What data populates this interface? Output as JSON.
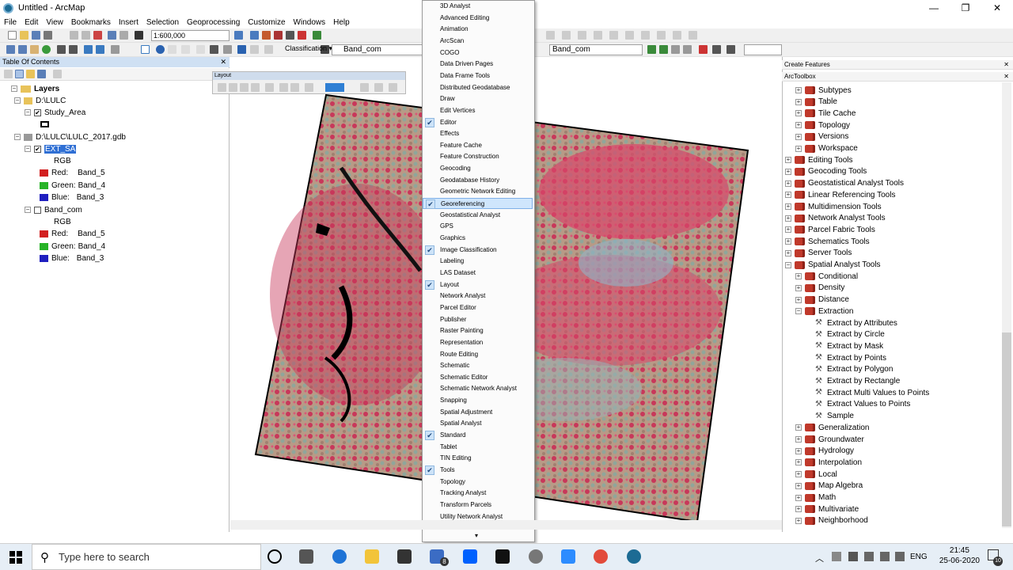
{
  "window": {
    "title": "Untitled - ArcMap",
    "min": "—",
    "max": "❐",
    "close": "✕"
  },
  "menubar": [
    "File",
    "Edit",
    "View",
    "Bookmarks",
    "Insert",
    "Selection",
    "Geoprocessing",
    "Customize",
    "Windows",
    "Help"
  ],
  "toolbar": {
    "scale": "1:600,000",
    "classification_label": "Classification ▾",
    "band_select": "Band_com",
    "band_select_2": "Band_com"
  },
  "toc": {
    "header": "Table Of Contents",
    "layers_root": "Layers",
    "group1": "D:\\LULC",
    "study_area": "Study_Area",
    "group2": "D:\\LULC\\LULC_2017.gdb",
    "ext_sa": "EXT_SA",
    "rgb1": "RGB",
    "red1": "Red:",
    "red1_band": "Band_5",
    "green1": "Green:",
    "green1_band": "Band_4",
    "blue1": "Blue:",
    "blue1_band": "Band_3",
    "band_com": "Band_com",
    "rgb2": "RGB",
    "red2": "Red:",
    "red2_band": "Band_5",
    "green2": "Green:",
    "green2_band": "Band_4",
    "blue2": "Blue:",
    "blue2_band": "Band_3"
  },
  "layout_toolbar": {
    "title": "Layout"
  },
  "toolbar_menu": [
    {
      "label": "3D Analyst",
      "checked": false
    },
    {
      "label": "Advanced Editing",
      "checked": false
    },
    {
      "label": "Animation",
      "checked": false
    },
    {
      "label": "ArcScan",
      "checked": false
    },
    {
      "label": "COGO",
      "checked": false
    },
    {
      "label": "Data Driven Pages",
      "checked": false
    },
    {
      "label": "Data Frame Tools",
      "checked": false
    },
    {
      "label": "Distributed Geodatabase",
      "checked": false
    },
    {
      "label": "Draw",
      "checked": false
    },
    {
      "label": "Edit Vertices",
      "checked": false
    },
    {
      "label": "Editor",
      "checked": true
    },
    {
      "label": "Effects",
      "checked": false
    },
    {
      "label": "Feature Cache",
      "checked": false
    },
    {
      "label": "Feature Construction",
      "checked": false
    },
    {
      "label": "Geocoding",
      "checked": false
    },
    {
      "label": "Geodatabase History",
      "checked": false
    },
    {
      "label": "Geometric Network Editing",
      "checked": false
    },
    {
      "label": "Georeferencing",
      "checked": true,
      "highlighted": true
    },
    {
      "label": "Geostatistical Analyst",
      "checked": false
    },
    {
      "label": "GPS",
      "checked": false
    },
    {
      "label": "Graphics",
      "checked": false
    },
    {
      "label": "Image Classification",
      "checked": true
    },
    {
      "label": "Labeling",
      "checked": false
    },
    {
      "label": "LAS Dataset",
      "checked": false
    },
    {
      "label": "Layout",
      "checked": true
    },
    {
      "label": "Network Analyst",
      "checked": false
    },
    {
      "label": "Parcel Editor",
      "checked": false
    },
    {
      "label": "Publisher",
      "checked": false
    },
    {
      "label": "Raster Painting",
      "checked": false
    },
    {
      "label": "Representation",
      "checked": false
    },
    {
      "label": "Route Editing",
      "checked": false
    },
    {
      "label": "Schematic",
      "checked": false
    },
    {
      "label": "Schematic Editor",
      "checked": false
    },
    {
      "label": "Schematic Network Analyst",
      "checked": false
    },
    {
      "label": "Snapping",
      "checked": false
    },
    {
      "label": "Spatial Adjustment",
      "checked": false
    },
    {
      "label": "Spatial Analyst",
      "checked": false
    },
    {
      "label": "Standard",
      "checked": true
    },
    {
      "label": "Tablet",
      "checked": false
    },
    {
      "label": "TIN Editing",
      "checked": false
    },
    {
      "label": "Tools",
      "checked": true
    },
    {
      "label": "Topology",
      "checked": false
    },
    {
      "label": "Tracking Analyst",
      "checked": false
    },
    {
      "label": "Transform Parcels",
      "checked": false
    },
    {
      "label": "Utility Network Analyst",
      "checked": false
    }
  ],
  "menu_more": "▾",
  "right_panels": {
    "create_features": "Create Features",
    "arctoolbox": "ArcToolbox"
  },
  "toolbox": {
    "subtypes": "Subtypes",
    "table": "Table",
    "tile_cache": "Tile Cache",
    "topology": "Topology",
    "versions": "Versions",
    "workspace": "Workspace",
    "editing_tools": "Editing Tools",
    "geocoding_tools": "Geocoding Tools",
    "geostatistical": "Geostatistical Analyst Tools",
    "linear_ref": "Linear Referencing Tools",
    "multidimension": "Multidimension Tools",
    "network_analyst": "Network Analyst Tools",
    "parcel_fabric": "Parcel Fabric Tools",
    "schematics": "Schematics Tools",
    "server_tools": "Server Tools",
    "spatial_analyst": "Spatial Analyst Tools",
    "conditional": "Conditional",
    "density": "Density",
    "distance": "Distance",
    "extraction": "Extraction",
    "extract_attributes": "Extract by Attributes",
    "extract_circle": "Extract by Circle",
    "extract_mask": "Extract by Mask",
    "extract_points": "Extract by Points",
    "extract_polygon": "Extract by Polygon",
    "extract_rectangle": "Extract by Rectangle",
    "extract_multi": "Extract Multi Values to Points",
    "extract_values": "Extract Values to Points",
    "sample": "Sample",
    "generalization": "Generalization",
    "groundwater": "Groundwater",
    "hydrology": "Hydrology",
    "interpolation": "Interpolation",
    "local": "Local",
    "map_algebra": "Map Algebra",
    "math": "Math",
    "multivariate": "Multivariate",
    "neighborhood": "Neighborhood"
  },
  "taskbar": {
    "search_placeholder": "Type here to search",
    "lang": "ENG",
    "time": "21:45",
    "date": "25-06-2020",
    "mail_badge": "8",
    "notif": "10"
  }
}
